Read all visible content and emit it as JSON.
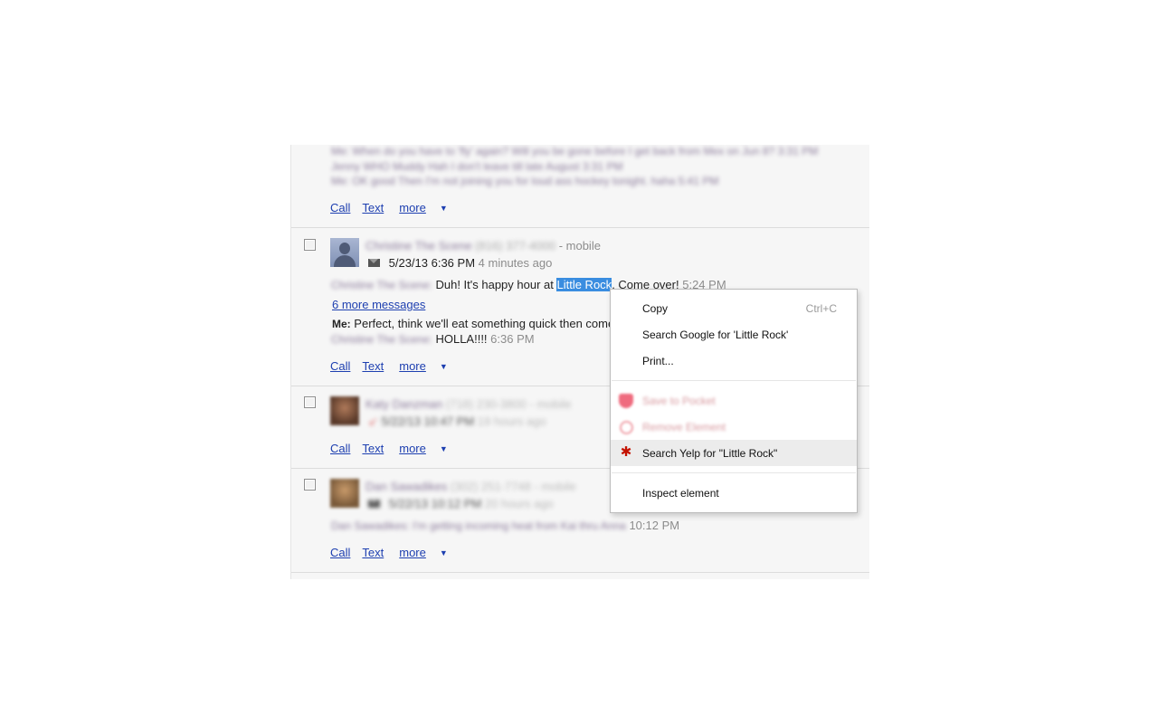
{
  "conversations": [
    {
      "blurred_lines": [
        "Me: When do you have to 'fly' again? Will you be gone before I get back from Mex on Jun 8?  3:31 PM",
        "Jenny WHO Muddy Hah  I don't leave till late August  3:31 PM",
        "Me: OK good  Then I'm not joining you for loud ass hockey tonight. haha  5:41 PM"
      ],
      "actions": {
        "call": "Call",
        "text": "Text",
        "more": "more"
      }
    },
    {
      "contact_name": "Christine The Scene",
      "phone": "(816) 377-4000",
      "phone_type": "- mobile",
      "timestamp": "5/23/13 6:36 PM",
      "age": "4 minutes ago",
      "sender_blur": "Christine The Scene:",
      "message_before": "Duh! It's happy hour at ",
      "selected_text": "Little Rock",
      "message_after": ". Come over!",
      "message_time": "5:24 PM",
      "more_messages": "6 more messages",
      "me_label": "Me:",
      "me_message": "Perfect, think we'll eat something quick then come",
      "reply_sender_blur": "Christine The Scene:",
      "reply_message": "HOLLA!!!!",
      "reply_time": "6:36 PM",
      "actions": {
        "call": "Call",
        "text": "Text",
        "more": "more"
      }
    },
    {
      "contact_name": "Katy Danzman",
      "phone": "(718) 230-3800",
      "phone_type": "- mobile",
      "timestamp": "5/22/13 10:47 PM",
      "age": "19 hours ago",
      "actions": {
        "call": "Call",
        "text": "Text",
        "more": "more"
      }
    },
    {
      "contact_name": "Dan Sawadikes",
      "phone": "(302) 251-7748",
      "phone_type": "- mobile",
      "timestamp": "5/22/13 10:12 PM",
      "age": "20 hours ago",
      "message_blur": "Dan Sawadikes: I'm getting incoming heat from Kai thru Anna",
      "message_time": "10:12 PM",
      "actions": {
        "call": "Call",
        "text": "Text",
        "more": "more"
      }
    }
  ],
  "context_menu": {
    "copy": "Copy",
    "copy_shortcut": "Ctrl+C",
    "search_google": "Search Google for 'Little Rock'",
    "print": "Print...",
    "save_pocket": "Save to Pocket",
    "remove_element": "Remove Element",
    "search_yelp": "Search Yelp for \"Little Rock\"",
    "yelp_glyph": "✱",
    "inspect": "Inspect element"
  },
  "colors": {
    "selection": "#3a8de0",
    "link": "#1d3fb0",
    "yelp_red": "#c41200"
  }
}
